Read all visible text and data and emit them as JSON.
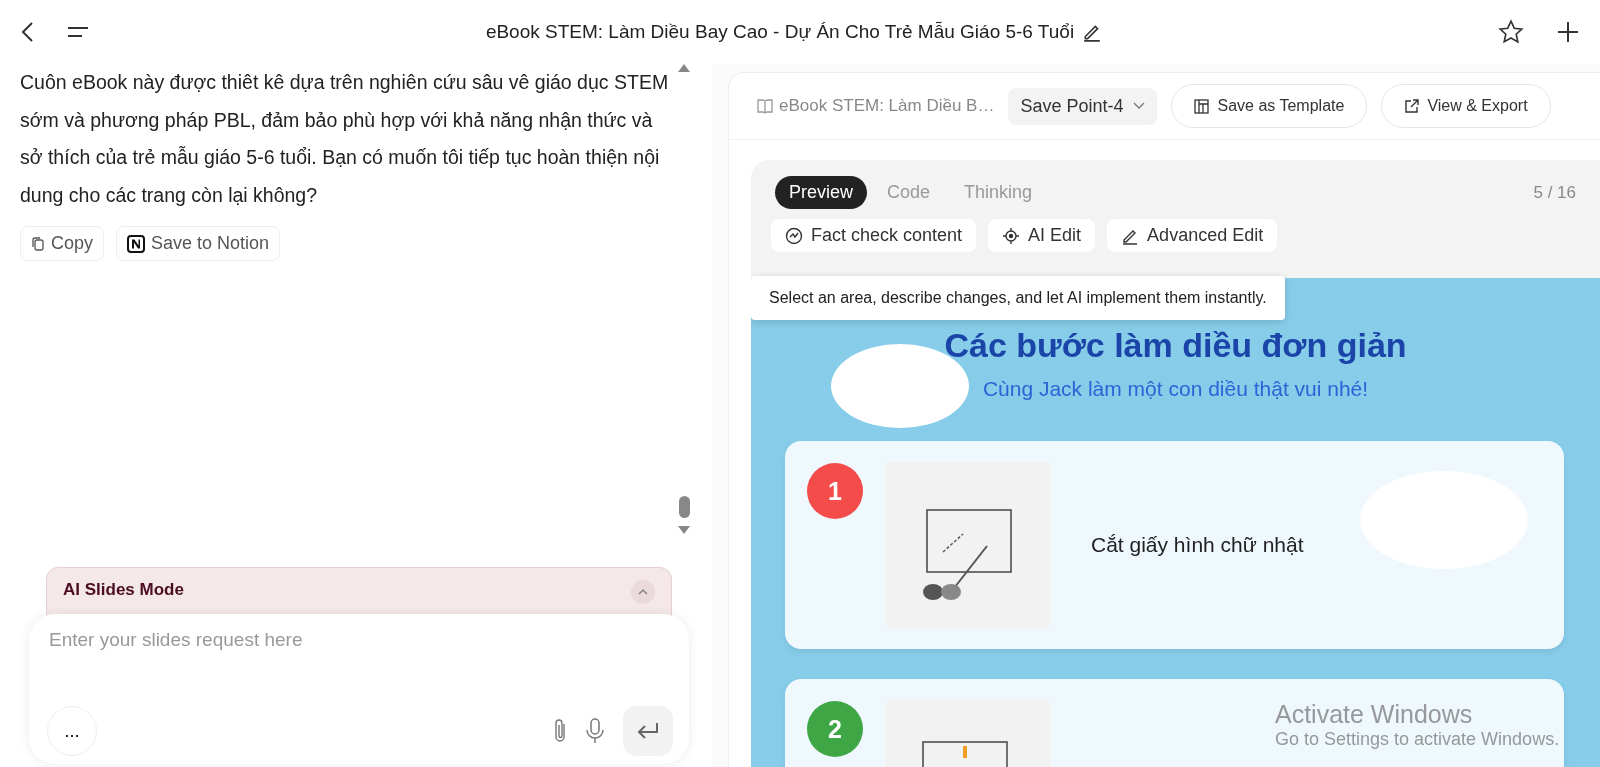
{
  "header": {
    "title": "eBook STEM: Làm Diều Bay Cao - Dự Án Cho Trẻ Mẫu Giáo 5-6 Tuổi"
  },
  "chat": {
    "message": "Cuôn eBook này được thiêt kê dựa trên nghiên cứu sâu vê giáo dục STEM sớm và phương pháp PBL, đảm bảo phù hợp với khả năng nhận thức và sở thích của trẻ mẫu giáo 5-6 tuổi. Bạn có muốn tôi tiếp tục hoàn thiện nội dung cho các trang còn lại không?",
    "actions": [
      {
        "kind": "copy",
        "label": "Copy"
      },
      {
        "kind": "notion",
        "label": "Save to Notion"
      }
    ],
    "mode": {
      "title": "AI Slides Mode"
    },
    "input": {
      "placeholder": "Enter your slides request here"
    },
    "more_button": "..."
  },
  "document": {
    "name": "eBook STEM: Làm Diều B…",
    "version": "Save Point-4",
    "buttons": [
      {
        "kind": "template",
        "label": "Save as Template"
      },
      {
        "kind": "export",
        "label": "View & Export"
      }
    ]
  },
  "preview": {
    "tabs": [
      {
        "label": "Preview",
        "selected": true
      },
      {
        "label": "Code",
        "selected": false
      },
      {
        "label": "Thinking",
        "selected": false
      }
    ],
    "page_counter": "5 / 16",
    "tools": [
      {
        "kind": "fact",
        "label": "Fact check content"
      },
      {
        "kind": "ai",
        "label": "AI Edit"
      },
      {
        "kind": "advanced",
        "label": "Advanced Edit"
      }
    ],
    "tooltip": "Select an area, describe changes, and let AI implement them instantly.",
    "slide": {
      "heading": "Các bước làm diều đơn giản",
      "subheading": "Cùng Jack làm một con diều thật vui nhé!",
      "steps": [
        {
          "number": "1",
          "color": "#f44b4b",
          "text": "Cắt giấy hình chữ nhật"
        },
        {
          "number": "2",
          "color": "#3fa646"
        }
      ]
    }
  },
  "activation_notice": {
    "title": "Activate Windows",
    "text": "Go to Settings to activate Windows."
  }
}
